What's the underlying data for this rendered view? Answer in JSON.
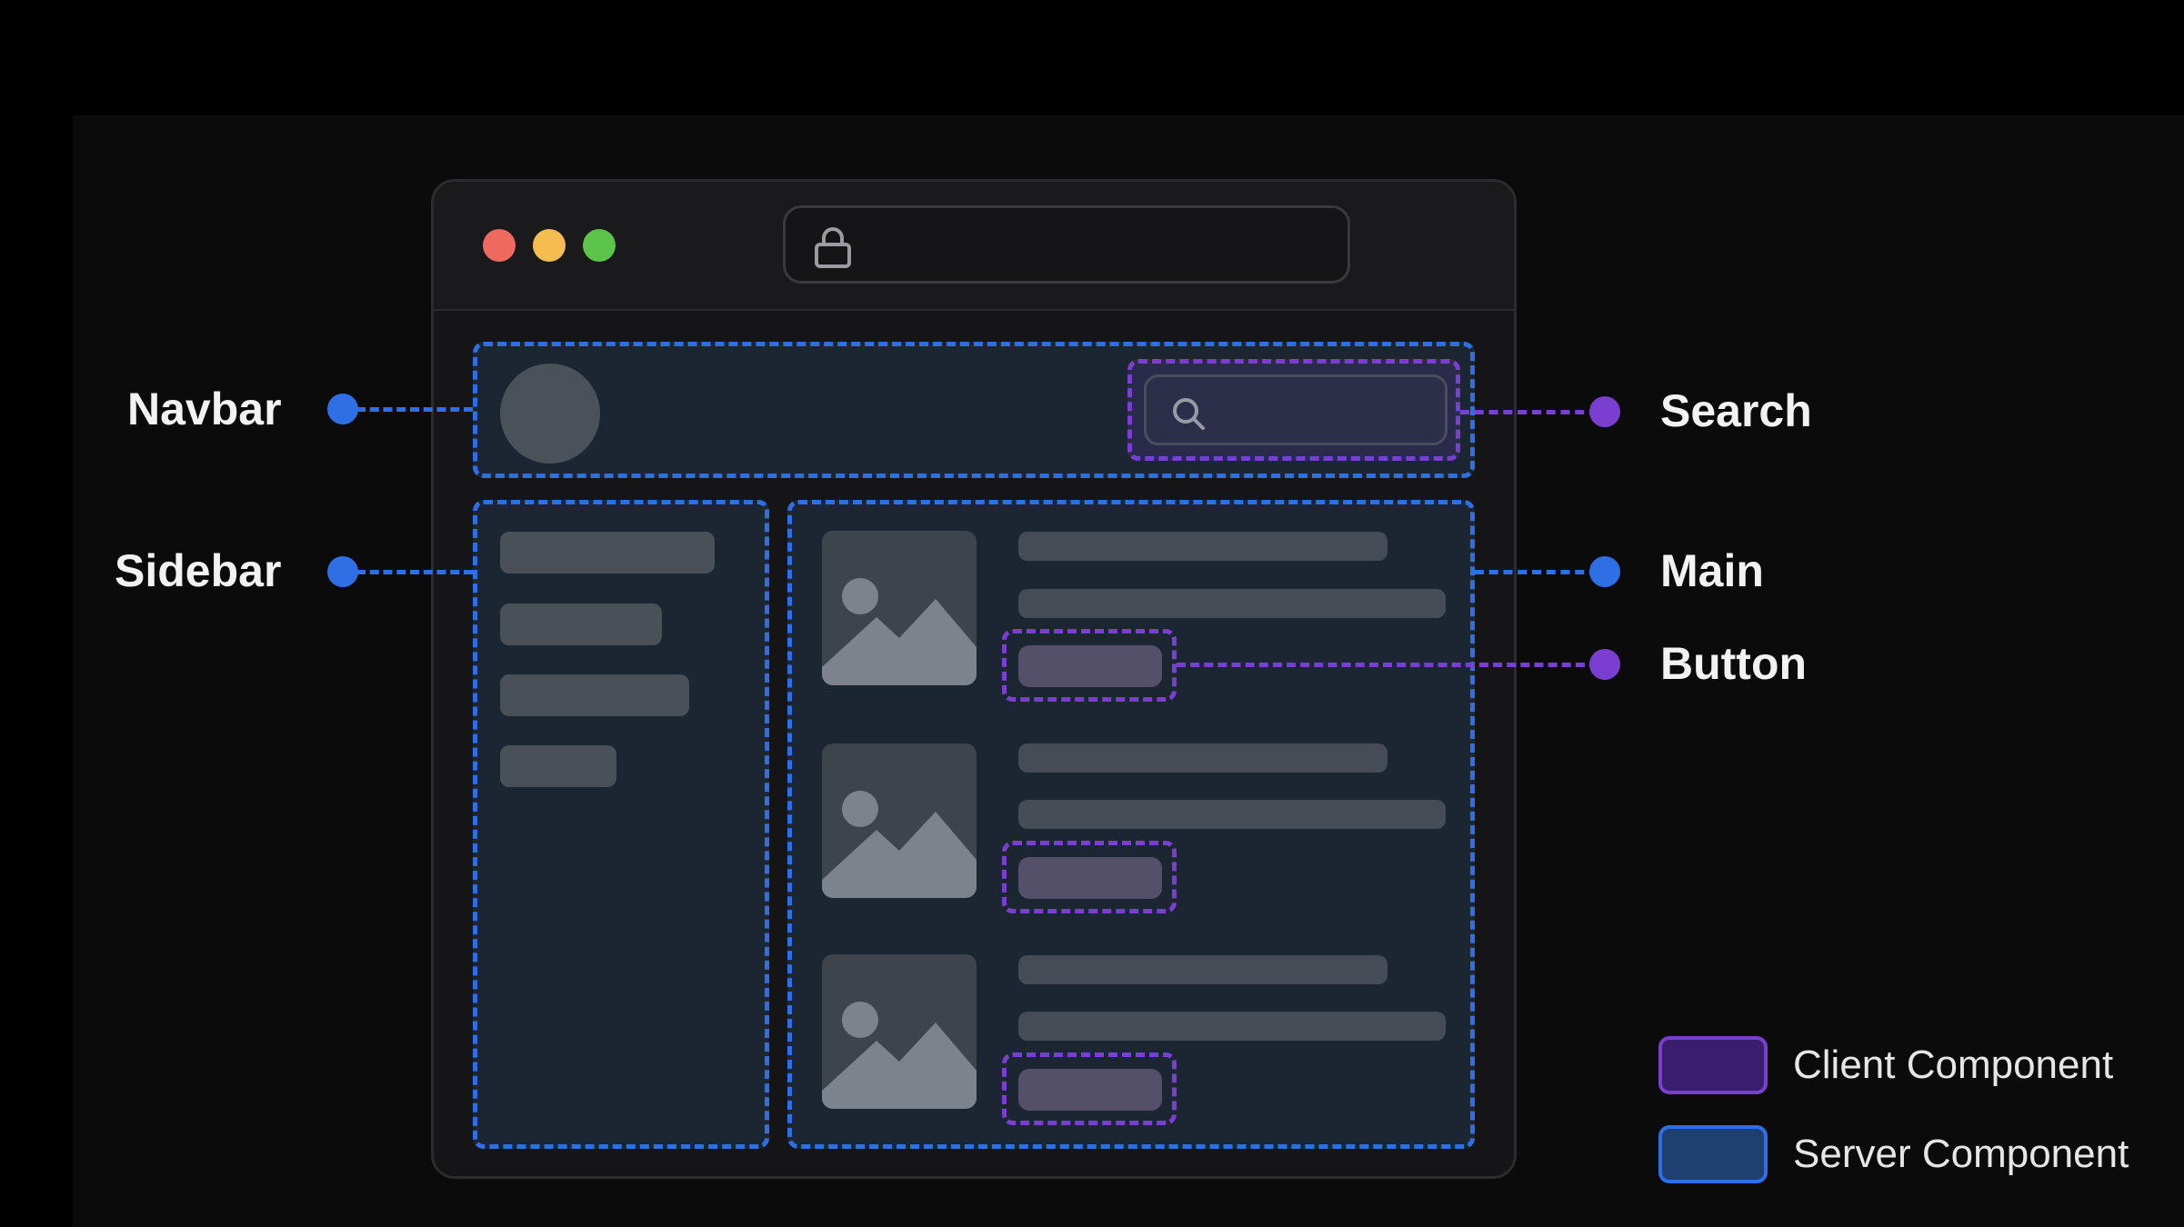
{
  "colors": {
    "server": "#2f6fe6",
    "client": "#7a3fd0",
    "window_red": "#ee6a5f",
    "window_yellow": "#f5bd4f",
    "window_green": "#5cc449"
  },
  "icons": {
    "url_bar": "lock-icon",
    "search": "search-icon",
    "image": "image-placeholder-icon"
  },
  "labels": {
    "navbar": "Navbar",
    "sidebar": "Sidebar",
    "search": "Search",
    "main": "Main",
    "button": "Button"
  },
  "legend": {
    "client": "Client Component",
    "server": "Server Component"
  }
}
